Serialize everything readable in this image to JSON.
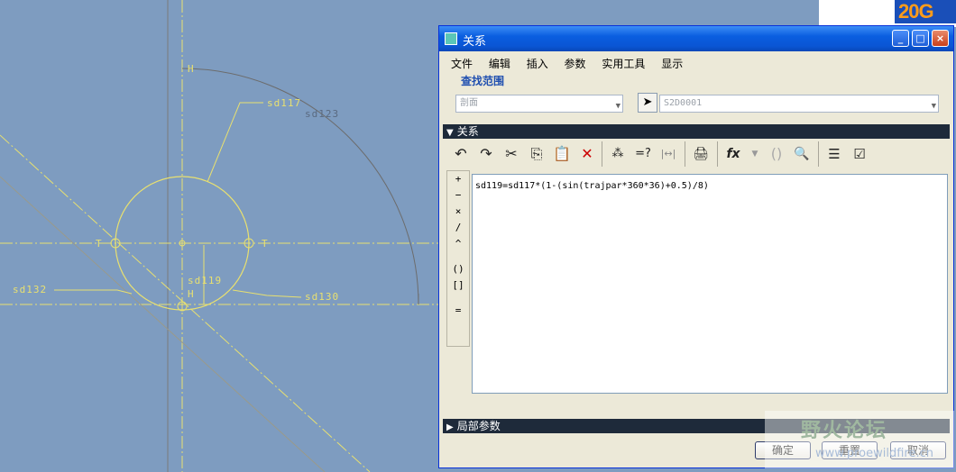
{
  "sketch": {
    "labels": {
      "sd117": "sd117",
      "sd123": "sd123",
      "sd119": "sd119",
      "sd132": "sd132",
      "sd130": "sd130",
      "h1": "H",
      "h2": "H",
      "t1": "T",
      "t2": "T"
    }
  },
  "corner": {
    "logo": "20G"
  },
  "dialog": {
    "title": "关系",
    "window_buttons": {
      "minimize": "_",
      "maximize": "□",
      "close": "×"
    },
    "menu": [
      "文件",
      "编辑",
      "插入",
      "参数",
      "实用工具",
      "显示"
    ],
    "find_scope": {
      "legend": "查找范围",
      "scope_value": "剖面",
      "object_value": "S2D0001"
    },
    "relations_section": "关系",
    "toolbar": {
      "undo": "↶",
      "redo": "↷",
      "cut": "✂",
      "copy": "⎘",
      "paste": "📋",
      "delete": "✕",
      "evaluate": "⁂",
      "verify": "=?",
      "dimension": "|↔|",
      "sort": "🖨",
      "function": "fx",
      "parenthesis": "()",
      "units": "🔍",
      "show_all": "☰",
      "check": "☑"
    },
    "operators": [
      "+",
      "−",
      "×",
      "/",
      "^",
      "()",
      "[]",
      "="
    ],
    "relation_text": "sd119=sd117*(1-(sin(trajpar*360*36)+0.5)/8)",
    "local_params_section": "局部参数",
    "buttons": {
      "ok": "确定",
      "reset": "重置",
      "cancel": "取消"
    }
  },
  "watermark": {
    "title": "野火论坛",
    "url": "www.proewildfire.cn"
  },
  "colors": {
    "background": "#7e9cc0",
    "sketch": "#e8e070",
    "titlebar": "#0a5ee0"
  }
}
